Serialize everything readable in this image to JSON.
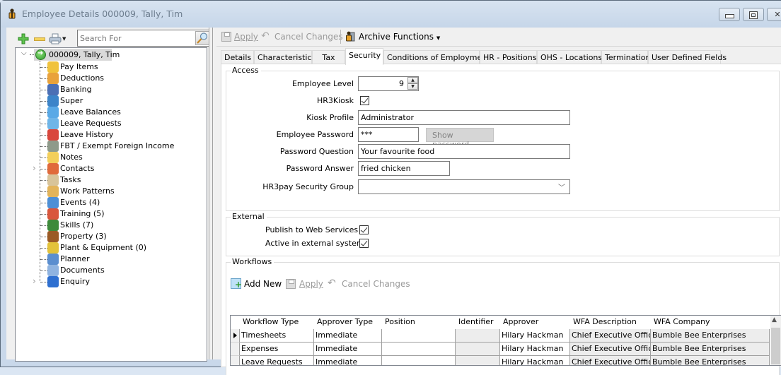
{
  "window": {
    "title": "Employee Details 000009, Tally, Tim",
    "controls": [
      "minimize",
      "maximize",
      "close"
    ]
  },
  "left_toolbar": {
    "add_icon": "plus-icon",
    "remove_icon": "minus-icon",
    "print_icon": "printer-icon",
    "search_placeholder": "Search For",
    "search_value": ""
  },
  "tree": {
    "root": {
      "label": "000009, Tally, Tim",
      "expanded": true,
      "selected": true
    },
    "items": [
      {
        "label": "Pay Items",
        "icon": "pay-items-icon",
        "expandable": false,
        "color": "#f0c23c"
      },
      {
        "label": "Deductions",
        "icon": "deductions-icon",
        "expandable": false,
        "color": "#e9a23b"
      },
      {
        "label": "Banking",
        "icon": "banking-icon",
        "expandable": false,
        "color": "#4b6fb5"
      },
      {
        "label": "Super",
        "icon": "super-icon",
        "expandable": false,
        "color": "#3c84c9"
      },
      {
        "label": "Leave Balances",
        "icon": "leave-balances-icon",
        "expandable": false,
        "color": "#5aa9e6"
      },
      {
        "label": "Leave Requests",
        "icon": "leave-requests-icon",
        "expandable": false,
        "color": "#6fb5e8"
      },
      {
        "label": "Leave History",
        "icon": "leave-history-icon",
        "expandable": false,
        "color": "#d9463c"
      },
      {
        "label": "FBT / Exempt Foreign Income",
        "icon": "fbt-icon",
        "expandable": false,
        "color": "#8e9a8a"
      },
      {
        "label": "Notes",
        "icon": "notes-icon",
        "expandable": false,
        "color": "#f3cf5a"
      },
      {
        "label": "Contacts",
        "icon": "contacts-icon",
        "expandable": true,
        "color": "#e06a3b"
      },
      {
        "label": "Tasks",
        "icon": "tasks-icon",
        "expandable": false,
        "color": "#d8c49a"
      },
      {
        "label": "Work Patterns",
        "icon": "work-patterns-icon",
        "expandable": false,
        "color": "#e3b45a"
      },
      {
        "label": "Events (4)",
        "icon": "events-icon",
        "expandable": false,
        "color": "#4d8fd6"
      },
      {
        "label": "Training (5)",
        "icon": "training-icon",
        "expandable": false,
        "color": "#d9563c"
      },
      {
        "label": "Skills (7)",
        "icon": "skills-icon",
        "expandable": false,
        "color": "#3d8a3a"
      },
      {
        "label": "Property (3)",
        "icon": "property-icon",
        "expandable": false,
        "color": "#9a5a25"
      },
      {
        "label": "Plant & Equipment (0)",
        "icon": "plant-equipment-icon",
        "expandable": false,
        "color": "#e3c23a"
      },
      {
        "label": "Planner",
        "icon": "planner-icon",
        "expandable": false,
        "color": "#5b8ecf"
      },
      {
        "label": "Documents",
        "icon": "documents-icon",
        "expandable": false,
        "color": "#8fb3e0"
      },
      {
        "label": "Enquiry",
        "icon": "enquiry-icon",
        "expandable": true,
        "color": "#2e6fd0"
      }
    ]
  },
  "right_toolbar": {
    "apply": "Apply",
    "cancel_changes": "Cancel Changes",
    "archive_functions": "Archive Functions"
  },
  "tabs": [
    {
      "label": "Details",
      "active": false
    },
    {
      "label": "Characteristics",
      "active": false
    },
    {
      "label": "Tax",
      "active": false
    },
    {
      "label": "Security",
      "active": true
    },
    {
      "label": "Conditions of Employment",
      "active": false
    },
    {
      "label": "HR - Positions",
      "active": false
    },
    {
      "label": "OHS - Locations",
      "active": false
    },
    {
      "label": "Termination",
      "active": false
    },
    {
      "label": "User Defined Fields",
      "active": false
    }
  ],
  "access": {
    "title": "Access",
    "employee_level_label": "Employee Level",
    "employee_level_value": "9",
    "hr3kiosk_label": "HR3Kiosk",
    "hr3kiosk_checked": true,
    "kiosk_profile_label": "Kiosk Profile",
    "kiosk_profile_value": "Administrator",
    "employee_password_label": "Employee Password",
    "employee_password_value": "***",
    "show_password_label": "Show password",
    "password_question_label": "Password Question",
    "password_question_value": "Your favourite food",
    "password_answer_label": "Password Answer",
    "password_answer_value": "fried chicken",
    "security_group_label": "HR3pay Security Group",
    "security_group_value": ""
  },
  "external": {
    "title": "External",
    "publish_label": "Publish to Web Services",
    "publish_checked": true,
    "active_label": "Active in external system",
    "active_checked": true
  },
  "workflows": {
    "title": "Workflows",
    "add_new": "Add New",
    "apply": "Apply",
    "cancel_changes": "Cancel Changes",
    "columns": [
      "Workflow Type",
      "Approver Type",
      "Position",
      "Identifier",
      "Approver",
      "WFA Description",
      "WFA Company"
    ],
    "rows": [
      [
        "Timesheets",
        "Immediate",
        "",
        "",
        "Hilary Hackman",
        "Chief Executive Officer",
        "Bumble Bee Enterprises"
      ],
      [
        "Expenses",
        "Immediate",
        "",
        "",
        "Hilary Hackman",
        "Chief Executive Officer",
        "Bumble Bee Enterprises"
      ],
      [
        "Leave Requests",
        "Immediate",
        "",
        "",
        "Hilary Hackman",
        "Chief Executive Officer",
        "Bumble Bee Enterprises"
      ]
    ],
    "current_row": 0
  }
}
